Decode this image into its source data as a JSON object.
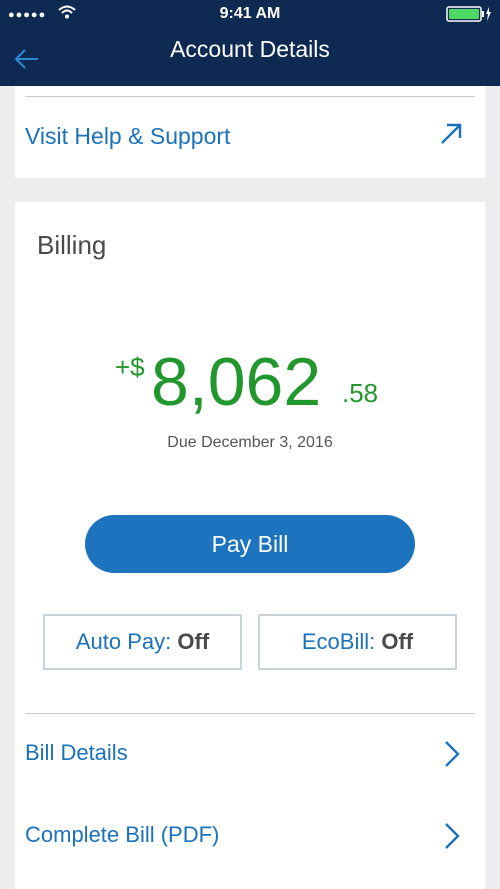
{
  "status_bar": {
    "time": "9:41 AM",
    "signal": "●●●●●"
  },
  "header": {
    "title": "Account Details"
  },
  "help": {
    "label": "Visit Help & Support"
  },
  "billing": {
    "title": "Billing",
    "amount_prefix": "+$",
    "amount_whole": "8,062",
    "amount_cents": ".58",
    "due": "Due December 3, 2016",
    "pay_label": "Pay Bill",
    "autopay_label": "Auto Pay:",
    "autopay_state": "Off",
    "ecobill_label": "EcoBill:",
    "ecobill_state": "Off"
  },
  "links": [
    {
      "label": "Bill Details"
    },
    {
      "label": "Complete Bill (PDF)"
    }
  ],
  "colors": {
    "header_bg": "#0f2a52",
    "accent": "#1e73be",
    "amount": "#22972d"
  }
}
